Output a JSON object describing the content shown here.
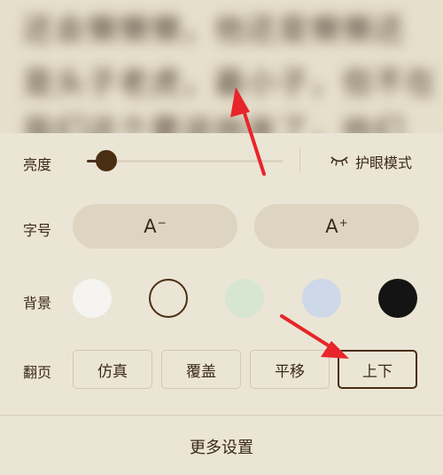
{
  "reading": {
    "lines": [
      "还会懒懒懒，他还是懒懒还",
      "是头子老虎，最小子，但不在",
      "我们这个要说他来了，他们"
    ]
  },
  "brightness": {
    "label": "亮度",
    "level": 0.1,
    "eye_mode_label": "护眼模式",
    "eye_icon": "eye-closed-icon"
  },
  "font_size": {
    "label": "字号",
    "decrease_label": "A",
    "decrease_mark": "−",
    "increase_label": "A",
    "increase_mark": "+"
  },
  "background": {
    "label": "背景",
    "colors": [
      "#f6f4f0",
      "#ebe5d5",
      "#d7e6d0",
      "#cdd9e8",
      "#141414"
    ],
    "selected_index": 1
  },
  "page_turn": {
    "label": "翻页",
    "modes": [
      "仿真",
      "覆盖",
      "平移",
      "上下"
    ],
    "selected_index": 3
  },
  "more_settings_label": "更多设置",
  "colors": {
    "accent": "#4a2e12",
    "annotation_arrow": "#e8252a"
  }
}
